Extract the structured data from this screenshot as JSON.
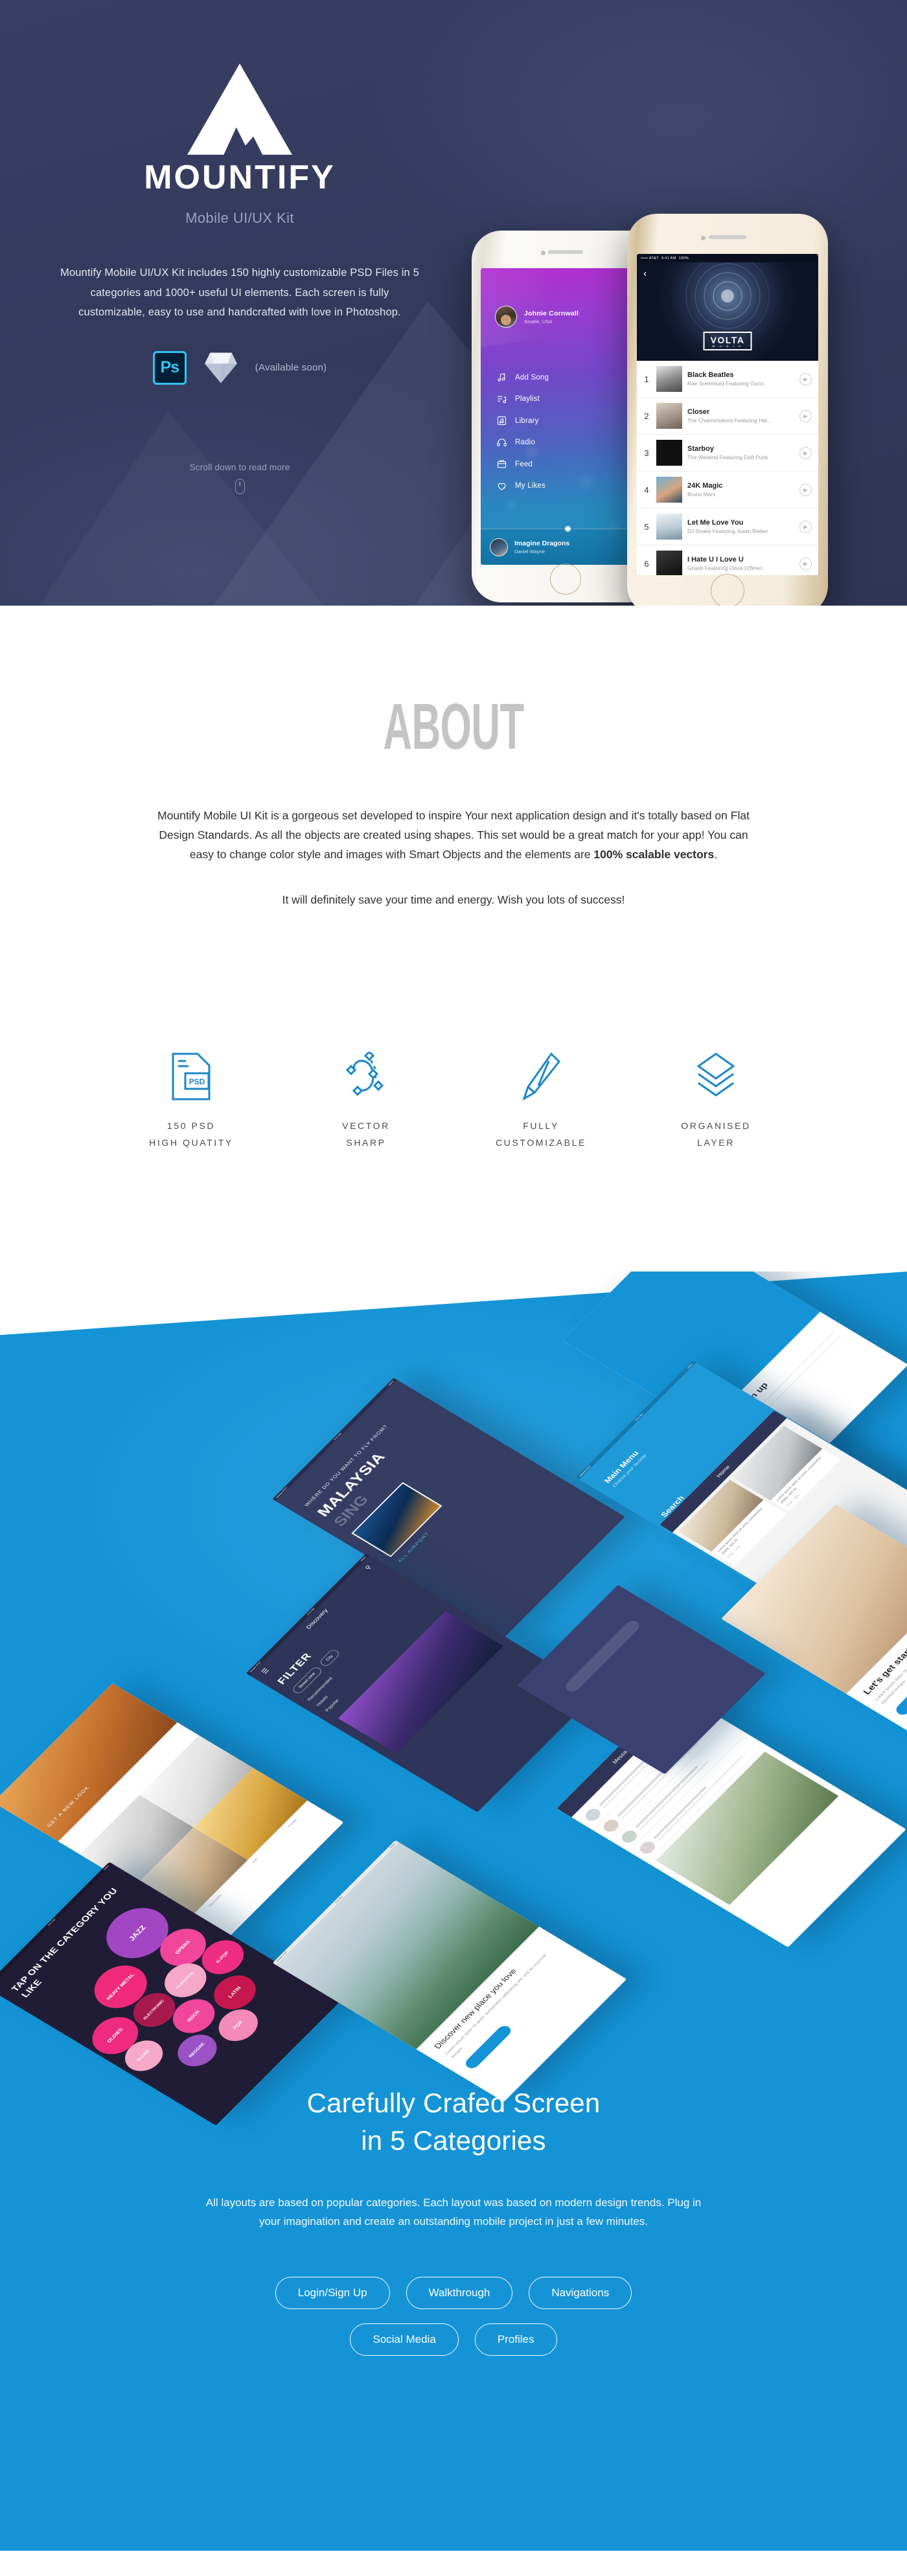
{
  "colors": {
    "hero_navy": "#343a5c",
    "accent_blue": "#1494d6",
    "icon_blue": "#1b87c9",
    "about_heading": "#c4c4c4"
  },
  "hero": {
    "brand_name": "MOUNTIFY",
    "brand_sub": "Mobile UI/UX Kit",
    "logo_icon": "mountain-logo-icon",
    "description": "Mountify Mobile UI/UX Kit includes 150 highly customizable PSD Files in 5 categories and 1000+ useful UI elements. Each screen is fully customizable, easy to use and handcrafted with love in Photoshop.",
    "badges": {
      "photoshop_label": "Ps",
      "photoshop_icon": "photoshop-icon",
      "sketch_icon": "sketch-diamond-icon",
      "available_soon": "(Available soon)"
    },
    "scroll_hint": "Scroll down to read more",
    "scroll_icon": "mouse-scroll-icon",
    "phone_left": {
      "user_name": "Johnie Cornwall",
      "user_location": "Seattle, USA",
      "menu": [
        {
          "label": "Add Song",
          "icon": "music-note-icon"
        },
        {
          "label": "Playlist",
          "icon": "playlist-icon"
        },
        {
          "label": "Library",
          "icon": "library-icon"
        },
        {
          "label": "Radio",
          "icon": "headphones-icon"
        },
        {
          "label": "Feed",
          "icon": "feed-icon"
        },
        {
          "label": "My Likes",
          "icon": "heart-plus-icon"
        }
      ],
      "now_playing": {
        "title": "Imagine Dragons",
        "subtitle": "Daniel Wayne"
      }
    },
    "phone_right": {
      "status_carrier": "••••• AT&T",
      "status_time": "9:41 AM",
      "status_battery": "100%",
      "back_icon": "chevron-left-icon",
      "logo_main": "VOLTA",
      "logo_sub": "M U S I C",
      "tracks": [
        {
          "rank": "1",
          "title": "Black Beatles",
          "artist": "Rae Sremmurd Featuring Gucci"
        },
        {
          "rank": "2",
          "title": "Closer",
          "artist": "The Chainsmokers Featuring Hal…"
        },
        {
          "rank": "3",
          "title": "Starboy",
          "artist": "The Weeknd Featuring Daft Punk"
        },
        {
          "rank": "4",
          "title": "24K Magic",
          "artist": "Bruno Mars"
        },
        {
          "rank": "5",
          "title": "Let Me Love You",
          "artist": "DJ Snake Featuring Justin Bieber"
        },
        {
          "rank": "6",
          "title": "I Hate U I Love U",
          "artist": "Gnash Featuring Olivia O'Brien"
        }
      ],
      "play_icon": "play-circle-icon"
    }
  },
  "about": {
    "heading": "ABOUT",
    "paragraph1_a": "Mountify Mobile UI Kit is a gorgeous set developed to inspire Your next application design and it's totally based on Flat Design Standards. As all the objects are created using shapes. This set would be a great match for your app! You can easy to change color style and images with Smart Objects and the elements are ",
    "paragraph1_bold": "100% scalable vectors",
    "paragraph1_end": ".",
    "paragraph2": "It will definitely save your time and energy. Wish you lots of success!"
  },
  "features": [
    {
      "icon": "psd-file-icon",
      "badge": "PSD",
      "line1": "150 PSD",
      "line2": "HIGH QUATITY"
    },
    {
      "icon": "vector-bezier-icon",
      "line1": "VECTOR",
      "line2": "SHARP"
    },
    {
      "icon": "pencil-icon",
      "line1": "FULLY",
      "line2": "CUSTOMIZABLE"
    },
    {
      "icon": "layers-icon",
      "line1": "ORGANISED",
      "line2": "LAYER"
    }
  ],
  "showcase": {
    "screens": [
      {
        "name": "flight-search",
        "status_time": "9:41 AM",
        "status_battery": "100%",
        "kicker": "WHERE DO YOU WANT TO FLY FROM?",
        "title": "MALAYSIA",
        "title2": "SING",
        "link": "ALL AIRPORT"
      },
      {
        "name": "signup",
        "title": "Let's sign up"
      },
      {
        "name": "main-menu",
        "title": "Main Menu",
        "subtitle": "Choose your favorite",
        "title2": "Search",
        "subtitle2": "find products or category"
      },
      {
        "name": "home-feed",
        "title": "Home",
        "card_text": "Lorem ipsum dolor sit amet, consectetur adipis, sed do",
        "likes": "172K",
        "comments": "223"
      },
      {
        "name": "get-started",
        "title": "Let's get started",
        "body": "Lorem ipsum dolor sit amet, consectetur adipisicing elit, sed do eiusmod tempor"
      },
      {
        "name": "discovery-filter",
        "title": "Discovery",
        "filter_label": "FILTER",
        "chips": [
          "Street view",
          "City"
        ],
        "items": [
          "Recommended",
          "Hotels",
          "Popular"
        ]
      },
      {
        "name": "shop-lookbook",
        "kicker": "GET A NEW LOOK",
        "tabs": [
          "Discovery",
          "Gift",
          "Profile"
        ]
      },
      {
        "name": "music-categories",
        "status_time": "9:41 AM",
        "status_battery": "100%",
        "title": "TAP ON THE CATEGORY YOU LIKE",
        "genres": [
          "JAZZ",
          "HEAVY METAL",
          "OPERA",
          "OLDIES",
          "ELECTRONIC",
          "CLASSICAL",
          "K-POP",
          "ROCK",
          "LATIN",
          "REGGAE",
          "POP",
          "BLUES",
          "POP"
        ]
      },
      {
        "name": "place-discover",
        "status_time": "9:41 AM",
        "status_battery": "100%",
        "title": "Discover new place you love",
        "body": "Lorem ipsum dolor sit amet, consectetur adipisicing elit, sed do eiusmod tempor"
      },
      {
        "name": "chat-list",
        "title": "Messages"
      }
    ]
  },
  "blue_section": {
    "heading_line1": "Carefully Crafed Screen",
    "heading_line2": "in 5 Categories",
    "body": "All layouts are based on popular categories. Each layout was based on modern design trends. Plug in your imagination and create an outstanding mobile project in just a few minutes.",
    "pills_row1": [
      "Login/Sign Up",
      "Walkthrough",
      "Navigations"
    ],
    "pills_row2": [
      "Social Media",
      "Profiles"
    ]
  }
}
